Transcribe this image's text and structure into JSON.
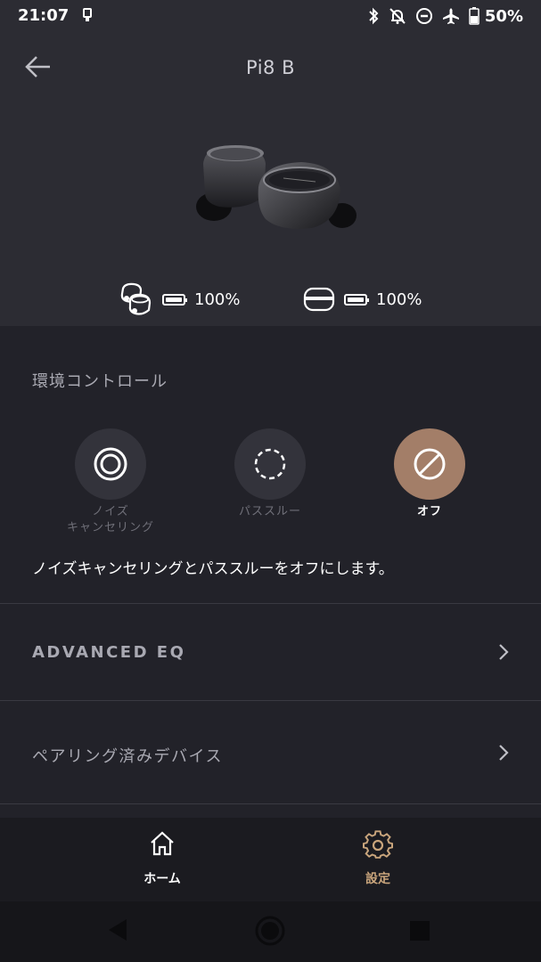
{
  "status": {
    "time": "21:07",
    "battery": "50%",
    "icons": [
      "usb-notification-icon",
      "bluetooth-icon",
      "notifications-off-icon",
      "do-not-disturb-icon",
      "airplane-mode-icon",
      "battery-icon"
    ]
  },
  "header": {
    "back_icon": "back-arrow-icon",
    "title": "Pi8 B"
  },
  "batteries": {
    "earbuds": {
      "icon": "earbuds-icon",
      "percent": "100%",
      "level": 1.0
    },
    "case": {
      "icon": "charging-case-icon",
      "percent": "100%",
      "level": 1.0
    }
  },
  "ambient": {
    "title": "環境コントロール",
    "modes": [
      {
        "label": "ノイズ",
        "label2": "キャンセリング",
        "icon": "noise-cancelling-icon",
        "active": false
      },
      {
        "label": "パススルー",
        "icon": "pass-through-icon",
        "active": false
      },
      {
        "label": "オフ",
        "icon": "off-icon",
        "active": true
      }
    ],
    "description": "ノイズキャンセリングとパススルーをオフにします。"
  },
  "menu": [
    {
      "label": "ADVANCED EQ",
      "icon": "chevron-right-icon"
    },
    {
      "label": "ペアリング済みデバイス",
      "icon": "chevron-right-icon"
    }
  ],
  "nav": {
    "home": {
      "label": "ホーム",
      "icon": "home-icon"
    },
    "settings": {
      "label": "設定",
      "icon": "gear-icon"
    }
  },
  "colors": {
    "background": "#222229",
    "header_bg": "#2c2c33",
    "accent": "#a37e68",
    "settings_active": "#c9a57c",
    "muted_text": "#a9a9b2"
  }
}
